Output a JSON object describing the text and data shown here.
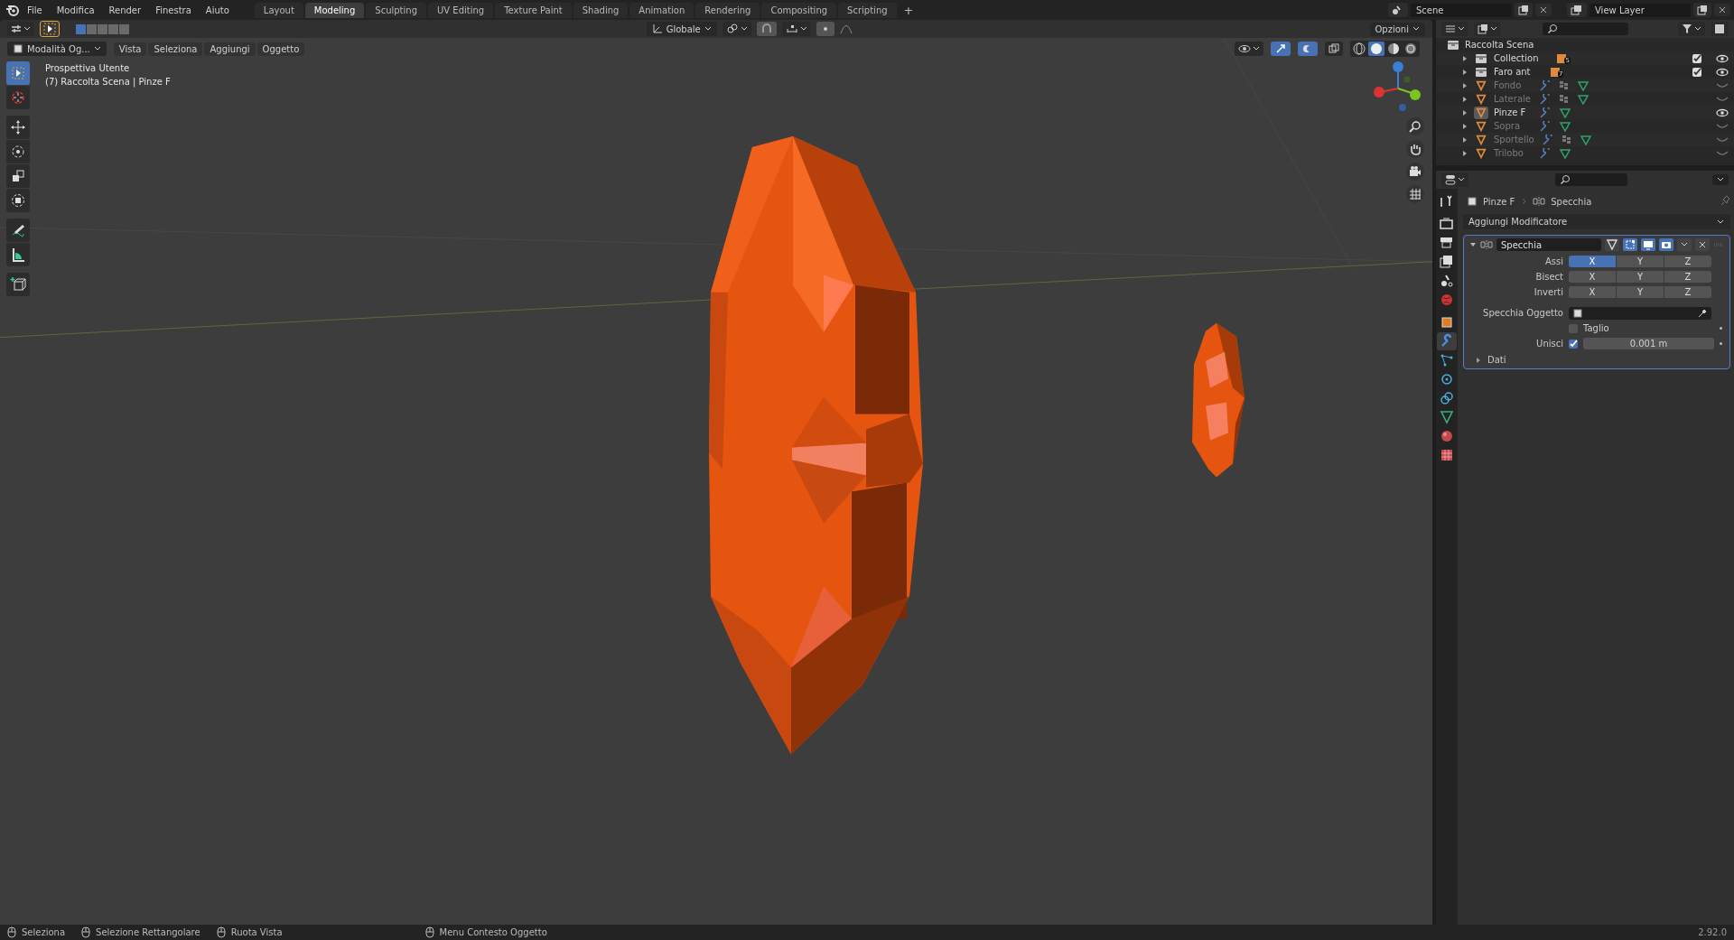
{
  "menu": [
    "File",
    "Modifica",
    "Render",
    "Finestra",
    "Aiuto"
  ],
  "workspaces": [
    {
      "label": "Layout",
      "selected": false
    },
    {
      "label": "Modeling",
      "selected": true
    },
    {
      "label": "Sculpting",
      "selected": false
    },
    {
      "label": "UV Editing",
      "selected": false
    },
    {
      "label": "Texture Paint",
      "selected": false
    },
    {
      "label": "Shading",
      "selected": false
    },
    {
      "label": "Animation",
      "selected": false
    },
    {
      "label": "Rendering",
      "selected": false
    },
    {
      "label": "Compositing",
      "selected": false
    },
    {
      "label": "Scripting",
      "selected": false
    }
  ],
  "add_workspace": "+",
  "scene": "Scene",
  "view_layer": "View Layer",
  "tool_header": {
    "orientation": "Globale",
    "options": "Opzioni"
  },
  "view_header": {
    "mode": "Modalità Og...",
    "menus": [
      "Vista",
      "Seleziona",
      "Aggiungi",
      "Oggetto"
    ]
  },
  "viewport": {
    "view_name": "Prospettiva Utente",
    "context": "(7) Raccolta Scena | Pinze F"
  },
  "tools": [
    {
      "kind": "select",
      "selected": true
    },
    {
      "kind": "cursor",
      "selected": false
    },
    {
      "kind": "move",
      "selected": false
    },
    {
      "kind": "rotate",
      "selected": false
    },
    {
      "kind": "scale",
      "selected": false
    },
    {
      "kind": "transform",
      "selected": false
    },
    {
      "kind": "annotate",
      "selected": false
    },
    {
      "kind": "measure",
      "selected": false
    },
    {
      "kind": "add-cube",
      "selected": false
    }
  ],
  "shading": [
    {
      "kind": "wireframe",
      "selected": false
    },
    {
      "kind": "solid",
      "selected": true
    },
    {
      "kind": "material",
      "selected": false
    },
    {
      "kind": "rendered",
      "selected": false
    }
  ],
  "outliner": {
    "root": "Raccolta Scena",
    "items": [
      {
        "name": "Collection",
        "kind": "collection",
        "count": "5",
        "checked": true,
        "visible": true,
        "selected": false
      },
      {
        "name": "Faro ant",
        "kind": "collection",
        "count": "7",
        "checked": true,
        "visible": true,
        "selected": false
      },
      {
        "name": "Fondo",
        "kind": "object",
        "grid_icon": true,
        "visible": false,
        "selected": false
      },
      {
        "name": "Laterale",
        "kind": "object",
        "grid_icon": true,
        "visible": false,
        "selected": false
      },
      {
        "name": "Pinze F",
        "kind": "object",
        "grid_icon": false,
        "visible": true,
        "selected": true
      },
      {
        "name": "Sopra",
        "kind": "object",
        "grid_icon": false,
        "visible": false,
        "selected": false
      },
      {
        "name": "Sportello",
        "kind": "object",
        "grid_icon": true,
        "visible": false,
        "selected": false
      },
      {
        "name": "Trilobo",
        "kind": "object",
        "grid_icon": false,
        "visible": false,
        "selected": false
      }
    ]
  },
  "properties": {
    "tabs": [
      {
        "kind": "tool",
        "selected": false
      },
      {
        "kind": "render",
        "selected": false
      },
      {
        "kind": "output",
        "selected": false
      },
      {
        "kind": "view-layer",
        "selected": false
      },
      {
        "kind": "scene",
        "selected": false
      },
      {
        "kind": "world",
        "selected": false
      },
      {
        "kind": "object",
        "selected": false
      },
      {
        "kind": "modifier",
        "selected": true
      },
      {
        "kind": "particles",
        "selected": false
      },
      {
        "kind": "physics",
        "selected": false
      },
      {
        "kind": "constraints",
        "selected": false
      },
      {
        "kind": "data",
        "selected": false
      },
      {
        "kind": "material",
        "selected": false
      },
      {
        "kind": "texture",
        "selected": false
      }
    ],
    "breadcrumb_object": "Pinze F",
    "breadcrumb_modifier": "Specchia",
    "add_modifier": "Aggiungi Modificatore",
    "modifier": {
      "name": "Specchia",
      "expanded": true,
      "axis_rows": [
        {
          "label": "Assi",
          "buttons": [
            {
              "label": "X",
              "selected": true
            },
            {
              "label": "Y",
              "selected": false
            },
            {
              "label": "Z",
              "selected": false
            }
          ]
        },
        {
          "label": "Bisect",
          "buttons": [
            {
              "label": "X",
              "selected": false
            },
            {
              "label": "Y",
              "selected": false
            },
            {
              "label": "Z",
              "selected": false
            }
          ]
        },
        {
          "label": "Inverti",
          "buttons": [
            {
              "label": "X",
              "selected": false
            },
            {
              "label": "Y",
              "selected": false
            },
            {
              "label": "Z",
              "selected": false
            }
          ]
        }
      ],
      "mirror_object_label": "Specchia Oggetto",
      "clip": {
        "label": "Taglio",
        "checked": false
      },
      "merge": {
        "label": "Unisci",
        "checked": true,
        "value": "0.001 m"
      },
      "subpanel": {
        "label": "Dati",
        "expanded": false
      }
    }
  },
  "status_bar": {
    "items": [
      "Seleziona",
      "Selezione Rettangolare",
      "Ruota Vista",
      "Menu Contesto Oggetto"
    ],
    "version": "2.92.0"
  }
}
